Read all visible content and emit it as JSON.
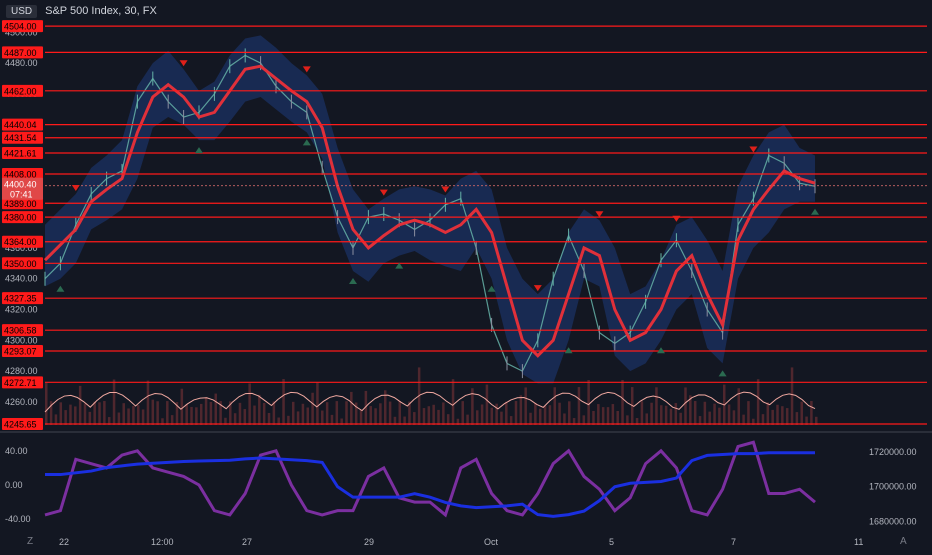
{
  "header": {
    "currency": "USD",
    "symbol": "S&P 500 Index, 30, FX"
  },
  "corner": {
    "left": "Z",
    "right": "A"
  },
  "colors": {
    "background": "#131722",
    "level_line": "#ff1a1a",
    "band_fill": "#1e3a7a",
    "ma_line": "#e0303a",
    "candle_up": "#66b3a8",
    "candle_down": "#8a8fa0",
    "volume": "#5a2a30",
    "volume_osc": "#f0a8a0",
    "osc_purple": "#7b2fa0",
    "osc_blue": "#1a2fe0",
    "signal_up": "#2a6a50",
    "signal_down": "#e0201a"
  },
  "chart_data": [
    {
      "type": "line",
      "title": "S&P 500 Index, 30, FX",
      "price_axis_ticks": [
        "4500.00",
        "4480.00",
        "4460.00",
        "4440.00",
        "4420.00",
        "4400.00",
        "4380.00",
        "4360.00",
        "4340.00",
        "4320.00",
        "4300.00",
        "4280.00",
        "4260.00"
      ],
      "time_axis_ticks": [
        "22",
        "12:00",
        "27",
        "29",
        "Oct",
        "5",
        "7",
        "11"
      ],
      "ylim": [
        4245,
        4508
      ],
      "levels": [
        4504.0,
        4487.0,
        4462.0,
        4440.04,
        4431.54,
        4421.61,
        4408.0,
        4389.0,
        4380.0,
        4364.0,
        4350.0,
        4327.35,
        4306.58,
        4293.07,
        4272.71,
        4245.65
      ],
      "level_labels": [
        "4504.00",
        "4487.00",
        "4462.00",
        "4440.04",
        "4431.54",
        "4421.61",
        "4408.00",
        "4389.00",
        "4380.00",
        "4364.00",
        "4350.00",
        "4327.35",
        "4306.58",
        "4293.07",
        "4272.71",
        "4245.65"
      ],
      "current_price": {
        "value": "4400.40",
        "countdown": "07:41"
      },
      "moving_average": [
        4352,
        4362,
        4372,
        4390,
        4398,
        4405,
        4435,
        4458,
        4466,
        4458,
        4445,
        4448,
        4462,
        4476,
        4478,
        4470,
        4462,
        4455,
        4438,
        4400,
        4372,
        4360,
        4368,
        4375,
        4378,
        4375,
        4370,
        4375,
        4385,
        4370,
        4335,
        4300,
        4290,
        4300,
        4330,
        4360,
        4355,
        4320,
        4300,
        4305,
        4320,
        4345,
        4355,
        4330,
        4310,
        4365,
        4385,
        4398,
        4410,
        4405,
        4402
      ],
      "band_upper": [
        4375,
        4385,
        4395,
        4412,
        4420,
        4430,
        4465,
        4480,
        4488,
        4476,
        4462,
        4468,
        4485,
        4496,
        4498,
        4490,
        4480,
        4472,
        4460,
        4425,
        4398,
        4385,
        4392,
        4398,
        4400,
        4398,
        4394,
        4405,
        4410,
        4398,
        4360,
        4340,
        4330,
        4340,
        4370,
        4385,
        4378,
        4360,
        4330,
        4335,
        4352,
        4375,
        4380,
        4365,
        4345,
        4400,
        4420,
        4435,
        4440,
        4425,
        4420
      ],
      "band_lower": [
        4335,
        4340,
        4350,
        4372,
        4378,
        4385,
        4405,
        4438,
        4445,
        4440,
        4430,
        4430,
        4442,
        4455,
        4458,
        4450,
        4442,
        4435,
        4418,
        4370,
        4345,
        4338,
        4350,
        4355,
        4358,
        4352,
        4348,
        4345,
        4360,
        4340,
        4300,
        4278,
        4272,
        4272,
        4300,
        4340,
        4335,
        4290,
        4280,
        4285,
        4300,
        4320,
        4330,
        4295,
        4285,
        4340,
        4360,
        4370,
        4385,
        4390,
        4390
      ],
      "price_points": [
        4340,
        4350,
        4375,
        4395,
        4405,
        4410,
        4455,
        4470,
        4455,
        4445,
        4448,
        4460,
        4478,
        4485,
        4480,
        4465,
        4455,
        4448,
        4412,
        4380,
        4360,
        4380,
        4382,
        4378,
        4372,
        4378,
        4388,
        4392,
        4360,
        4310,
        4285,
        4280,
        4300,
        4340,
        4368,
        4345,
        4305,
        4298,
        4305,
        4325,
        4352,
        4365,
        4345,
        4320,
        4305,
        4375,
        4392,
        4420,
        4415,
        4402,
        4400
      ]
    },
    {
      "type": "line",
      "title": "",
      "left_axis_ticks": [
        "40.00",
        "0.00",
        "-40.00"
      ],
      "right_axis_ticks": [
        "1720000.00",
        "1700000.00",
        "1680000.00"
      ],
      "ylim_left": [
        -55,
        55
      ],
      "ylim_right": [
        1674000,
        1728000
      ],
      "series": [
        {
          "values": [
            -35,
            -30,
            30,
            25,
            20,
            35,
            40,
            20,
            15,
            10,
            0,
            -30,
            -35,
            -10,
            35,
            40,
            0,
            -30,
            -35,
            -30,
            -30,
            10,
            20,
            -15,
            -20,
            -20,
            -35,
            20,
            30,
            -10,
            -30,
            -35,
            -10,
            25,
            40,
            10,
            -5,
            -30,
            -15,
            25,
            40,
            20,
            -30,
            -35,
            -5,
            45,
            50,
            -10,
            -10,
            -5,
            -20
          ]
        },
        {
          "values": [
            1707000,
            1707000,
            1708000,
            1709000,
            1711000,
            1712000,
            1713000,
            1713500,
            1714000,
            1714500,
            1714800,
            1715000,
            1715200,
            1716000,
            1716500,
            1716000,
            1715500,
            1715000,
            1714000,
            1700000,
            1694000,
            1694000,
            1694000,
            1694000,
            1696000,
            1694000,
            1691000,
            1689000,
            1688000,
            1688500,
            1689000,
            1690000,
            1684000,
            1683000,
            1684000,
            1686000,
            1692000,
            1700000,
            1702000,
            1702500,
            1703000,
            1705000,
            1715000,
            1718000,
            1718500,
            1719000,
            1719000,
            1719500,
            1719500,
            1719500,
            1719500
          ]
        }
      ]
    }
  ]
}
